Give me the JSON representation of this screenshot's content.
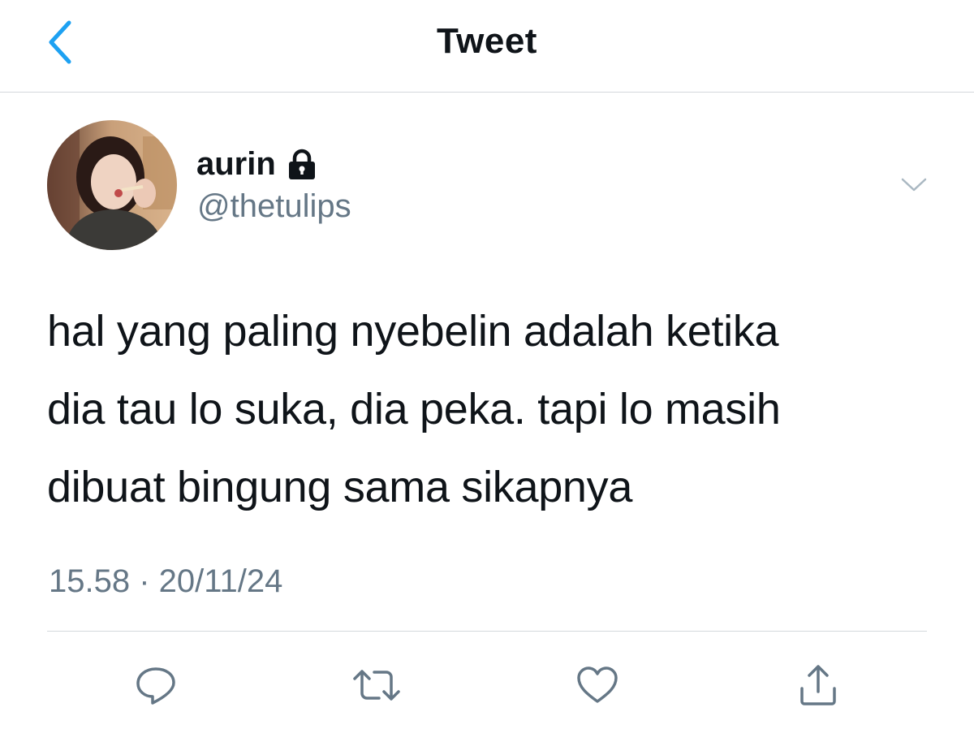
{
  "header": {
    "title": "Tweet",
    "back_icon": "chevron-left-icon"
  },
  "author": {
    "display_name": "aurin",
    "handle": "@thetulips",
    "protected_icon": "lock-icon"
  },
  "tweet": {
    "lines": [
      "hal yang paling nyebelin adalah ketika",
      "dia tau lo suka, dia peka. tapi lo masih",
      "dibuat bingung sama sikapnya"
    ],
    "timestamp": "15.58 · 20/11/24"
  },
  "actions": {
    "icons": [
      "reply-icon",
      "retweet-icon",
      "like-icon",
      "share-icon"
    ]
  },
  "colors": {
    "accent": "#1da1f2",
    "secondary_text": "#657786",
    "icon_gray": "#657786",
    "divider": "#d4d8dc"
  }
}
